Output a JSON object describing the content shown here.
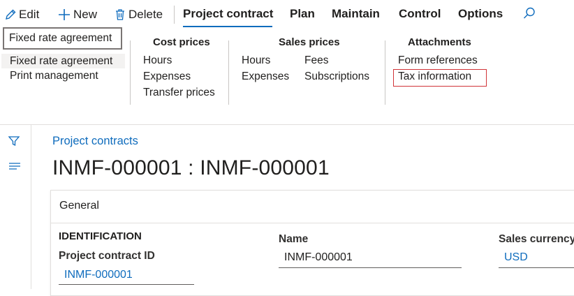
{
  "actions": {
    "edit": "Edit",
    "new": "New",
    "delete": "Delete"
  },
  "tabs": [
    "Project contract",
    "Plan",
    "Maintain",
    "Control",
    "Options"
  ],
  "menu": {
    "fixed_rate_group": "Fixed rate agreement",
    "fixed_rate_items": [
      "Fixed rate agreement",
      "Print management"
    ],
    "cost_prices": {
      "title": "Cost prices",
      "items": [
        "Hours",
        "Expenses",
        "Transfer prices"
      ]
    },
    "sales_prices": {
      "title": "Sales prices",
      "col1": [
        "Hours",
        "Expenses"
      ],
      "col2": [
        "Fees",
        "Subscriptions"
      ]
    },
    "attachments": {
      "title": "Attachments",
      "items": [
        "Form references",
        "Tax information"
      ]
    }
  },
  "page": {
    "breadcrumb": "Project contracts",
    "title": "INMF-000001 : INMF-000001"
  },
  "general": {
    "header": "General",
    "section": "IDENTIFICATION",
    "contract_id_label": "Project contract ID",
    "contract_id_value": "INMF-000001",
    "name_label": "Name",
    "name_value": "INMF-000001",
    "currency_label": "Sales currency",
    "currency_value": "USD"
  },
  "colors": {
    "accent": "#0f6cbd",
    "highlight_border": "#d13438"
  }
}
